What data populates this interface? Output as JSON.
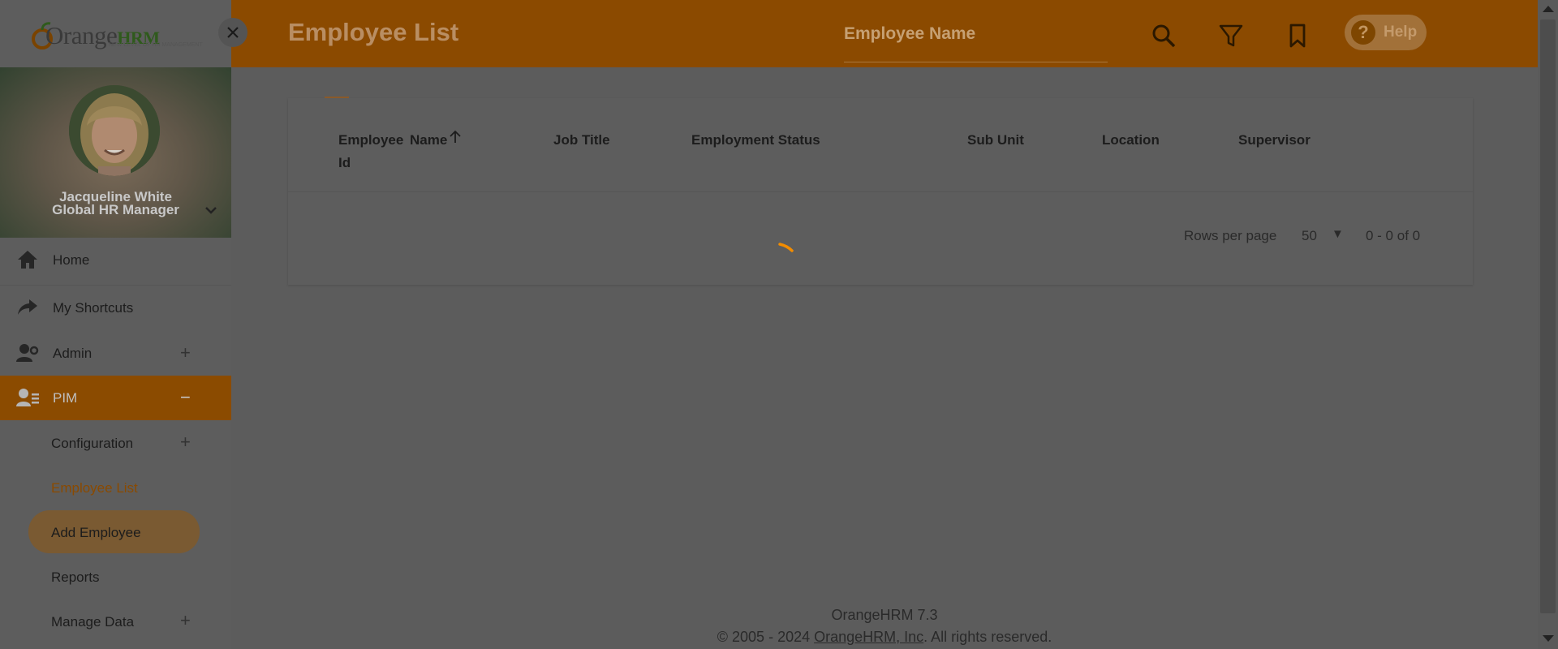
{
  "brand": {
    "name_part1": "Orange",
    "name_part2": "HRM",
    "tagline": "NEW LEVEL OF HR MANAGEMENT"
  },
  "user": {
    "name": "Jacqueline White",
    "role": "Global HR Manager"
  },
  "sidebar": {
    "items": [
      {
        "label": "Home",
        "icon": "home-icon"
      },
      {
        "label": "My Shortcuts",
        "icon": "share-icon"
      },
      {
        "label": "Admin",
        "icon": "admin-icon",
        "expand": "+"
      },
      {
        "label": "PIM",
        "icon": "pim-icon",
        "expand": "−"
      }
    ],
    "pim_children": [
      {
        "label": "Configuration",
        "expand": "+"
      },
      {
        "label": "Employee List"
      },
      {
        "label": "Add Employee"
      },
      {
        "label": "Reports"
      },
      {
        "label": "Manage Data",
        "expand": "+"
      }
    ]
  },
  "header": {
    "title": "Employee List",
    "search_placeholder": "Employee Name",
    "help_label": "Help",
    "help_symbol": "?"
  },
  "table": {
    "columns": [
      "Employee",
      "Id",
      "Name",
      "Job Title",
      "Employment Status",
      "Sub Unit",
      "Location",
      "Supervisor"
    ],
    "sort_column": "Name",
    "rows": []
  },
  "pagination": {
    "rows_per_page_label": "Rows per page",
    "rows_per_page": "50",
    "range": "0 - 0 of 0"
  },
  "footer": {
    "version": "OrangeHRM 7.3",
    "copyright_prefix": "© 2005 - 2024 ",
    "company": "OrangeHRM, Inc",
    "rights": ". All rights reserved."
  },
  "colors": {
    "accent": "#8b4a00",
    "spinner": "#f28c00",
    "overlay_gray": "#5c5c5c"
  }
}
